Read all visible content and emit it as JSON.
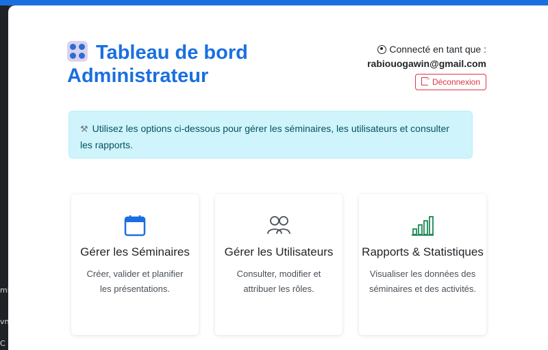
{
  "header": {
    "title_line1": "Tableau de bord",
    "title_line2": "Administrateur",
    "connected_label": "Connecté en tant que :",
    "email": "rabiouogawin@gmail.com",
    "logout_label": "Déconnexion"
  },
  "alert": {
    "text": "Utilisez les options ci-dessous pour gérer les séminaires, les utilisateurs et consulter les rapports."
  },
  "cards": [
    {
      "title": "Gérer les Séminaires",
      "description": "Créer, valider et planifier les présentations.",
      "icon": "calendar-icon",
      "color": "#1a6fe0"
    },
    {
      "title": "Gérer les Utilisateurs",
      "description": "Consulter, modifier et attribuer les rôles.",
      "icon": "people-icon",
      "color": "#495057"
    },
    {
      "title": "Rapports & Statistiques",
      "description": "Visualiser les données des séminaires et des activités.",
      "icon": "bar-chart-icon",
      "color": "#198754"
    }
  ],
  "side_strip": [
    "ml",
    "vn",
    "C"
  ],
  "colors": {
    "accent": "#1a6fe0",
    "danger": "#dc3545",
    "info_bg": "#cff4fc"
  }
}
